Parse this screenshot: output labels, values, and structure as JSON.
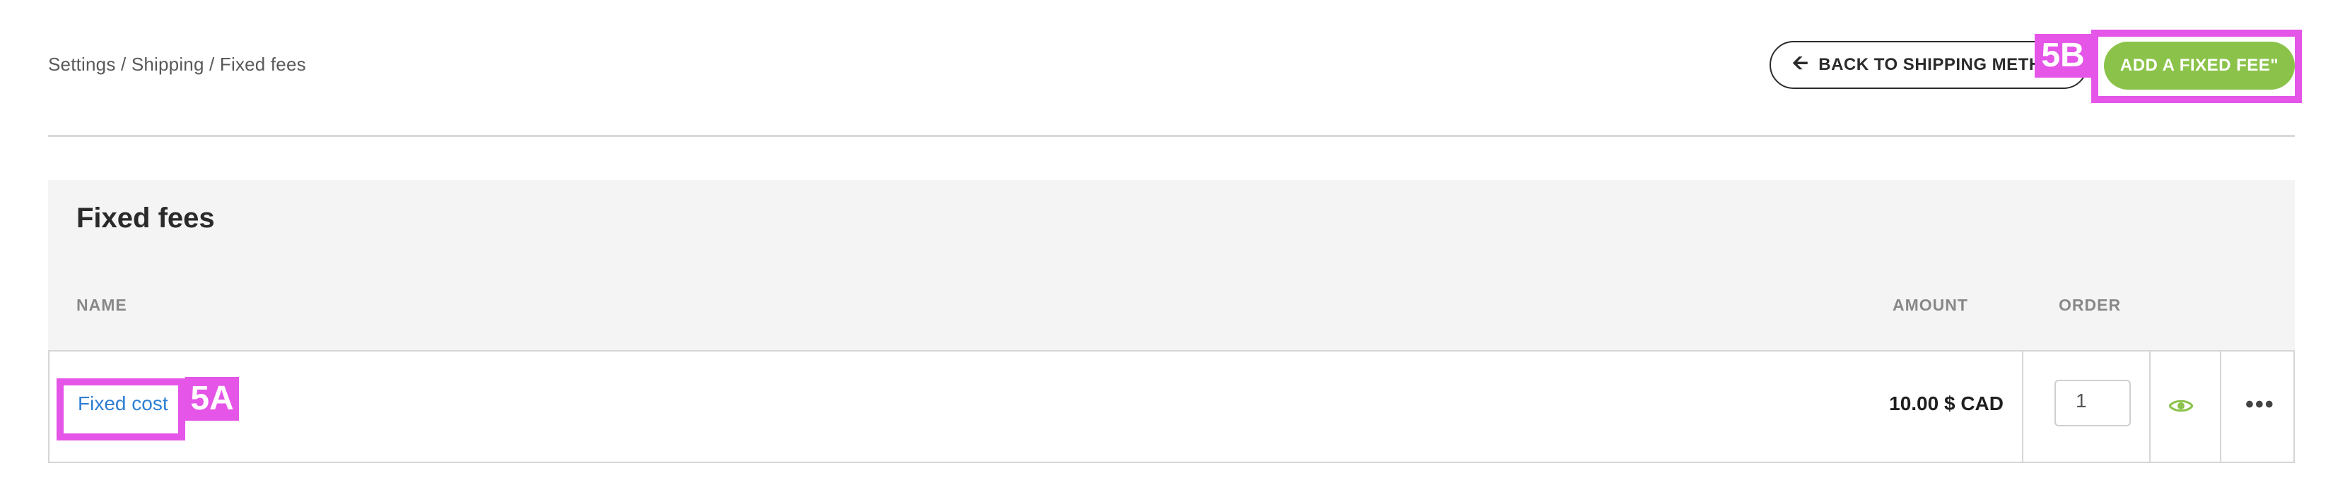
{
  "breadcrumb": "Settings / Shipping / Fixed fees",
  "toolbar": {
    "back_label": "BACK TO SHIPPING METHODS",
    "back_icon": "arrow-left-icon",
    "add_label": "ADD A FIXED FEE\""
  },
  "annotations": {
    "a": "5A",
    "b": "5B"
  },
  "panel": {
    "title": "Fixed fees",
    "columns": {
      "name": "NAME",
      "amount": "AMOUNT",
      "order": "ORDER"
    }
  },
  "rows": [
    {
      "name": "Fixed cost",
      "amount": "10.00 $ CAD",
      "order": "1",
      "visibility_icon": "eye-icon",
      "menu_icon": "more-options-icon"
    }
  ],
  "colors": {
    "accent": "#8bc34a",
    "link": "#2f7fd3",
    "highlight": "#e455e8"
  }
}
